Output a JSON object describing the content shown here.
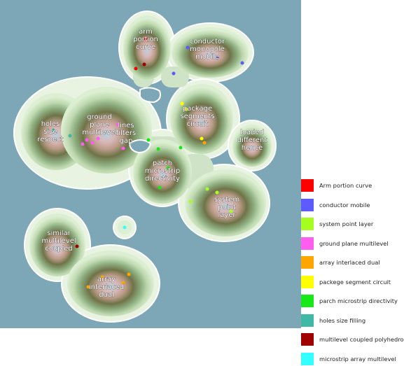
{
  "background_color": "#7da7b6",
  "clusters": [
    {
      "id": "arm",
      "lines": [
        "arm",
        "portion",
        "curve"
      ]
    },
    {
      "id": "conductor",
      "lines": [
        "conductor",
        "monopole",
        "mobile"
      ]
    },
    {
      "id": "package",
      "lines": [
        "package",
        "segments",
        "circuit"
      ]
    },
    {
      "id": "loaded",
      "lines": [
        "loaded",
        "different",
        "hence"
      ]
    },
    {
      "id": "holes",
      "lines": [
        "holes",
        "size",
        "respect"
      ]
    },
    {
      "id": "ground",
      "lines": [
        "ground",
        "plane",
        "multilevel"
      ]
    },
    {
      "id": "lines",
      "lines": [
        "lines",
        "filters",
        "gap"
      ]
    },
    {
      "id": "patch",
      "lines": [
        "patch",
        "microstrip",
        "directivity"
      ]
    },
    {
      "id": "system",
      "lines": [
        "system",
        "point",
        "layer"
      ]
    },
    {
      "id": "similar",
      "lines": [
        "similar",
        "multilevel",
        "coupled"
      ]
    },
    {
      "id": "array",
      "lines": [
        "array",
        "interlaced",
        "dual"
      ]
    }
  ],
  "legend": [
    {
      "label": "Arm portion curve",
      "color": "#ff0000"
    },
    {
      "label": "conductor mobile",
      "color": "#5b5bff"
    },
    {
      "label": "system point layer",
      "color": "#a7ff1f"
    },
    {
      "label": "ground plane multilevel",
      "color": "#ff5cf0"
    },
    {
      "label": "array interlaced dual",
      "color": "#ffa500"
    },
    {
      "label": "packege segment circuit",
      "color": "#ffff00"
    },
    {
      "label": "parch microstrip directivity",
      "color": "#18e818"
    },
    {
      "label": "holes size filling",
      "color": "#3fb8a6"
    },
    {
      "label": "multilevel coupled polyhedrons",
      "color": "#a00000"
    },
    {
      "label": "microstrip array multilevel",
      "color": "#33ffff"
    }
  ]
}
